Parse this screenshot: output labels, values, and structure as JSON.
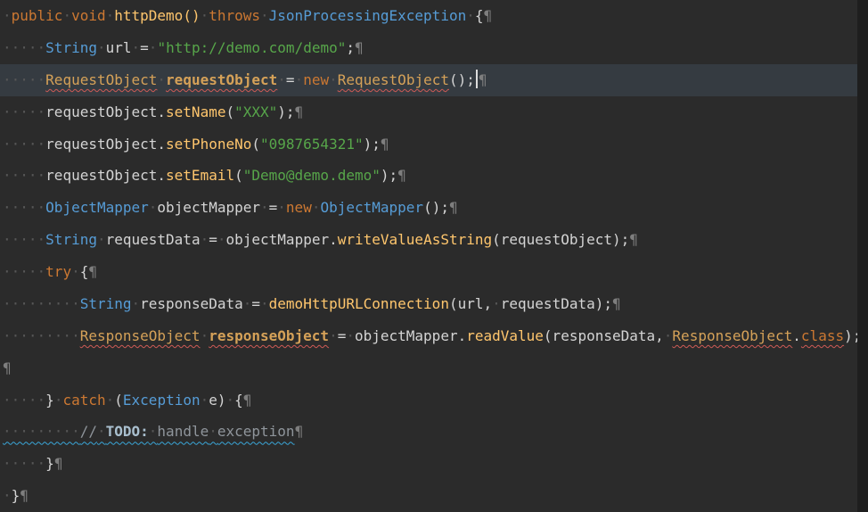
{
  "editor": {
    "caret_line": 2,
    "colors": {
      "bg": "#2b2b2b",
      "current_line": "#353b41",
      "keyword": "#cc7832",
      "type": "#569cd6",
      "method": "#ffc66d",
      "string": "#57a64a",
      "plain": "#d4d4d4",
      "whitespace": "#575757",
      "pilcrow": "#7e7e7e",
      "unresolved": "#d5a158",
      "comment": "#8f959b",
      "todo": "#a9bfce",
      "error": "#cf5b56",
      "info": "#3aa7d9",
      "caret": "#dcdcdc",
      "ruler": "#1e1e1e"
    },
    "lines": [
      {
        "segments": [
          {
            "t": "ws",
            "x": "·"
          },
          {
            "t": "kw",
            "x": "public"
          },
          {
            "t": "ws",
            "x": "·"
          },
          {
            "t": "kw",
            "x": "void"
          },
          {
            "t": "ws",
            "x": "·"
          },
          {
            "t": "me",
            "x": "httpDemo()"
          },
          {
            "t": "ws",
            "x": "·"
          },
          {
            "t": "kw",
            "x": "throws"
          },
          {
            "t": "ws",
            "x": "·"
          },
          {
            "t": "ty",
            "x": "JsonProcessingException"
          },
          {
            "t": "ws",
            "x": "·"
          },
          {
            "t": "pl",
            "x": "{"
          },
          {
            "t": "pil",
            "x": "¶"
          }
        ]
      },
      {
        "segments": [
          {
            "t": "ws",
            "x": "·····"
          },
          {
            "t": "ty",
            "x": "String"
          },
          {
            "t": "ws",
            "x": "·"
          },
          {
            "t": "pl",
            "x": "url"
          },
          {
            "t": "ws",
            "x": "·"
          },
          {
            "t": "pl",
            "x": "="
          },
          {
            "t": "ws",
            "x": "·"
          },
          {
            "t": "st",
            "x": "\"http://demo.com/demo\""
          },
          {
            "t": "pl",
            "x": ";"
          },
          {
            "t": "pil",
            "x": "¶"
          }
        ]
      },
      {
        "segments": [
          {
            "t": "ws",
            "x": "·····"
          },
          {
            "t": "un",
            "x": "RequestObject",
            "u": "red"
          },
          {
            "t": "ws",
            "x": "·"
          },
          {
            "t": "uv",
            "x": "requestObject",
            "u": "red"
          },
          {
            "t": "ws",
            "x": "·"
          },
          {
            "t": "pl",
            "x": "="
          },
          {
            "t": "ws",
            "x": "·"
          },
          {
            "t": "kw",
            "x": "new"
          },
          {
            "t": "ws",
            "x": "·"
          },
          {
            "t": "un",
            "x": "RequestObject",
            "u": "red"
          },
          {
            "t": "pl",
            "x": "();"
          },
          {
            "t": "caret"
          },
          {
            "t": "pil",
            "x": "¶"
          }
        ]
      },
      {
        "segments": [
          {
            "t": "ws",
            "x": "·····"
          },
          {
            "t": "pl",
            "x": "requestObject."
          },
          {
            "t": "me",
            "x": "setName"
          },
          {
            "t": "pl",
            "x": "("
          },
          {
            "t": "st",
            "x": "\"XXX\""
          },
          {
            "t": "pl",
            "x": ");"
          },
          {
            "t": "pil",
            "x": "¶"
          }
        ]
      },
      {
        "segments": [
          {
            "t": "ws",
            "x": "·····"
          },
          {
            "t": "pl",
            "x": "requestObject."
          },
          {
            "t": "me",
            "x": "setPhoneNo"
          },
          {
            "t": "pl",
            "x": "("
          },
          {
            "t": "st",
            "x": "\"0987654321\""
          },
          {
            "t": "pl",
            "x": ");"
          },
          {
            "t": "pil",
            "x": "¶"
          }
        ]
      },
      {
        "segments": [
          {
            "t": "ws",
            "x": "·····"
          },
          {
            "t": "pl",
            "x": "requestObject."
          },
          {
            "t": "me",
            "x": "setEmail"
          },
          {
            "t": "pl",
            "x": "("
          },
          {
            "t": "st",
            "x": "\"Demo@demo.demo\""
          },
          {
            "t": "pl",
            "x": ");"
          },
          {
            "t": "pil",
            "x": "¶"
          }
        ]
      },
      {
        "segments": [
          {
            "t": "ws",
            "x": "·····"
          },
          {
            "t": "ty",
            "x": "ObjectMapper"
          },
          {
            "t": "ws",
            "x": "·"
          },
          {
            "t": "pl",
            "x": "objectMapper"
          },
          {
            "t": "ws",
            "x": "·"
          },
          {
            "t": "pl",
            "x": "="
          },
          {
            "t": "ws",
            "x": "·"
          },
          {
            "t": "kw",
            "x": "new"
          },
          {
            "t": "ws",
            "x": "·"
          },
          {
            "t": "ty",
            "x": "ObjectMapper"
          },
          {
            "t": "pl",
            "x": "();"
          },
          {
            "t": "pil",
            "x": "¶"
          }
        ]
      },
      {
        "segments": [
          {
            "t": "ws",
            "x": "·····"
          },
          {
            "t": "ty",
            "x": "String"
          },
          {
            "t": "ws",
            "x": "·"
          },
          {
            "t": "pl",
            "x": "requestData"
          },
          {
            "t": "ws",
            "x": "·"
          },
          {
            "t": "pl",
            "x": "="
          },
          {
            "t": "ws",
            "x": "·"
          },
          {
            "t": "pl",
            "x": "objectMapper."
          },
          {
            "t": "me",
            "x": "writeValueAsString"
          },
          {
            "t": "pl",
            "x": "(requestObject);"
          },
          {
            "t": "pil",
            "x": "¶"
          }
        ]
      },
      {
        "segments": [
          {
            "t": "ws",
            "x": "·····"
          },
          {
            "t": "kw",
            "x": "try"
          },
          {
            "t": "ws",
            "x": "·"
          },
          {
            "t": "pl",
            "x": "{"
          },
          {
            "t": "pil",
            "x": "¶"
          }
        ]
      },
      {
        "segments": [
          {
            "t": "ws",
            "x": "·········"
          },
          {
            "t": "ty",
            "x": "String"
          },
          {
            "t": "ws",
            "x": "·"
          },
          {
            "t": "pl",
            "x": "responseData"
          },
          {
            "t": "ws",
            "x": "·"
          },
          {
            "t": "pl",
            "x": "="
          },
          {
            "t": "ws",
            "x": "·"
          },
          {
            "t": "me",
            "x": "demoHttpURLConnection"
          },
          {
            "t": "pl",
            "x": "(url,"
          },
          {
            "t": "ws",
            "x": "·"
          },
          {
            "t": "pl",
            "x": "requestData);"
          },
          {
            "t": "pil",
            "x": "¶"
          }
        ]
      },
      {
        "segments": [
          {
            "t": "ws",
            "x": "·········"
          },
          {
            "t": "un",
            "x": "ResponseObject",
            "u": "red"
          },
          {
            "t": "ws",
            "x": "·"
          },
          {
            "t": "uv",
            "x": "responseObject",
            "u": "red"
          },
          {
            "t": "ws",
            "x": "·"
          },
          {
            "t": "pl",
            "x": "="
          },
          {
            "t": "ws",
            "x": "·"
          },
          {
            "t": "pl",
            "x": "objectMapper."
          },
          {
            "t": "me",
            "x": "readValue"
          },
          {
            "t": "pl",
            "x": "(responseData,"
          },
          {
            "t": "ws",
            "x": "·"
          },
          {
            "t": "un",
            "x": "ResponseObject",
            "u": "red"
          },
          {
            "t": "pl",
            "x": "."
          },
          {
            "t": "kw",
            "x": "class",
            "u": "red"
          },
          {
            "t": "pl",
            "x": ");"
          },
          {
            "t": "pil",
            "x": "¶"
          }
        ]
      },
      {
        "segments": [
          {
            "t": "pil",
            "x": "¶"
          }
        ]
      },
      {
        "segments": [
          {
            "t": "ws",
            "x": "·····"
          },
          {
            "t": "pl",
            "x": "}"
          },
          {
            "t": "ws",
            "x": "·"
          },
          {
            "t": "kw",
            "x": "catch"
          },
          {
            "t": "ws",
            "x": "·"
          },
          {
            "t": "pl",
            "x": "("
          },
          {
            "t": "ty",
            "x": "Exception"
          },
          {
            "t": "ws",
            "x": "·"
          },
          {
            "t": "pl",
            "x": "e)"
          },
          {
            "t": "ws",
            "x": "·"
          },
          {
            "t": "pl",
            "x": "{"
          },
          {
            "t": "pil",
            "x": "¶"
          }
        ]
      },
      {
        "segments": [
          {
            "t": "ws",
            "x": "·········",
            "u": "cyan"
          },
          {
            "t": "cm",
            "x": "//",
            "u": "cyan"
          },
          {
            "t": "ws",
            "x": "·",
            "u": "cyan"
          },
          {
            "t": "td",
            "x": "TODO:",
            "u": "cyan"
          },
          {
            "t": "ws",
            "x": "·",
            "u": "cyan"
          },
          {
            "t": "cm",
            "x": "handle",
            "u": "cyan"
          },
          {
            "t": "ws",
            "x": "·",
            "u": "cyan"
          },
          {
            "t": "cm",
            "x": "exception",
            "u": "cyan"
          },
          {
            "t": "pil",
            "x": "¶"
          }
        ]
      },
      {
        "segments": [
          {
            "t": "ws",
            "x": "·····"
          },
          {
            "t": "pl",
            "x": "}"
          },
          {
            "t": "pil",
            "x": "¶"
          }
        ]
      },
      {
        "segments": [
          {
            "t": "ws",
            "x": "·"
          },
          {
            "t": "pl",
            "x": "}"
          },
          {
            "t": "pil",
            "x": "¶"
          }
        ]
      }
    ]
  }
}
